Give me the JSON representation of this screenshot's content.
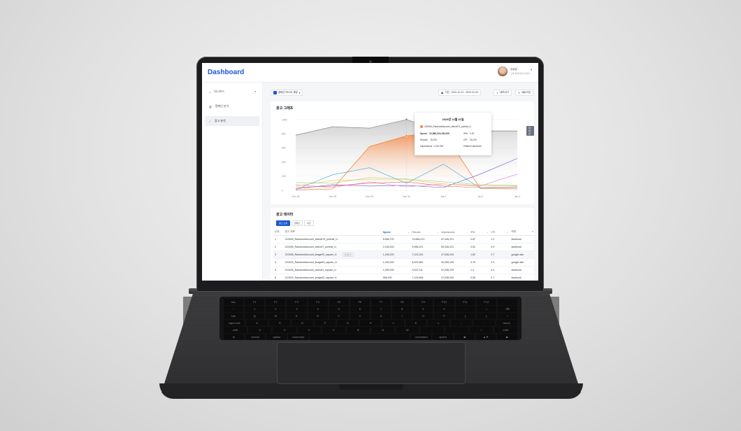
{
  "app": {
    "title": "Dashboard",
    "user": {
      "name": "김유정",
      "subtitle": "고객 데이터 분석 담당자"
    }
  },
  "sidebar": {
    "items": [
      {
        "label": "대시보드",
        "caret": "▾"
      },
      {
        "label": "캠페인 분석"
      },
      {
        "label": "광고 분석"
      }
    ]
  },
  "toolbar": {
    "account": "캠페인 마스터 계정",
    "date_range": "기간 : 2021.12.12 - 2022.01.03",
    "export": "내보내기",
    "refresh": "새로고침"
  },
  "chart_card": {
    "title": "광고 그래프",
    "end_badge": "최대값",
    "tooltip": {
      "title": "2024년 12월 31일",
      "series": "210506_Randomdiscount_video674_portrait_U",
      "rows": [
        {
          "label": "Spend",
          "value": "32,866,015,150,005"
        },
        {
          "label": "Results",
          "value": "15,220"
        },
        {
          "label": "Impressions",
          "value": "1,215,220"
        }
      ],
      "rows_right": [
        {
          "label": "IPM",
          "value": "0.87"
        },
        {
          "label": "CPI",
          "value": "15,220"
        },
        {
          "label": "Platform",
          "value": "facebook"
        }
      ]
    }
  },
  "chart_data": {
    "type": "line",
    "categories": [
      "Dec 28",
      "Dec 29",
      "Dec 30",
      "Dec 31",
      "Jan 1",
      "Jan 2",
      "Jan 3"
    ],
    "yticks": [
      "1000",
      "800",
      "600",
      "400",
      "200",
      "0"
    ],
    "ylim": [
      0,
      1000
    ],
    "series": [
      {
        "name": "총합",
        "color": "#8f8f8f",
        "area": true,
        "values": [
          780,
          900,
          880,
          1000,
          840,
          840,
          840
        ]
      },
      {
        "name": "210506_Randomdiscount_video674_portrait_U",
        "color": "#f4863e",
        "area": true,
        "values": [
          5,
          20,
          620,
          770,
          830,
          25,
          20
        ]
      },
      {
        "color": "#26a8e0",
        "values": [
          10,
          220,
          320,
          100,
          370,
          30,
          40
        ]
      },
      {
        "color": "#5b57d6",
        "values": [
          20,
          80,
          60,
          70,
          40,
          230,
          450
        ]
      },
      {
        "color": "#e07ad6",
        "values": [
          80,
          40,
          120,
          50,
          90,
          60,
          230
        ]
      },
      {
        "color": "#f2c14e",
        "values": [
          60,
          140,
          150,
          150,
          90,
          70,
          60
        ]
      },
      {
        "color": "#9bd17a",
        "values": [
          110,
          100,
          180,
          160,
          120,
          80,
          70
        ]
      },
      {
        "color": "#ef5a5a",
        "values": [
          40,
          60,
          100,
          120,
          60,
          40,
          50
        ]
      }
    ]
  },
  "table_card": {
    "title": "광고 데이터",
    "tabs": [
      "광고 소재",
      "캠페인",
      "세트"
    ],
    "headers": [
      "순위",
      "광고 제목",
      "Spend",
      "Results",
      "Impressions",
      "IPM",
      "CPI",
      "매체"
    ],
    "row_action": "상세보기",
    "rows": [
      [
        "1",
        "210505_Randomdiscount_video675_portrait_U",
        "8,566,720",
        "13,666,221",
        "87,036,221",
        "0.87",
        "1.2",
        "facebook"
      ],
      [
        "2",
        "210405_Randomdiscount_video97_portrait_U",
        "2,165,220",
        "9,066,221",
        "50,036,221",
        "0.52",
        "0.9",
        "facebook"
      ],
      [
        "3",
        "210305_Randomdiscount_image92_square_K",
        "1,165,220",
        "7,122,151",
        "47,036,220",
        "1.82",
        "2.7",
        "google ads"
      ],
      [
        "4",
        "210223_Randomdiscount_image83_square_U",
        "1,032,000",
        "8,022,662",
        "42,036,100",
        "0.76",
        "1.3",
        "google ads"
      ],
      [
        "5",
        "210425_Randomdiscount_video81_square_U",
        "1,005,330",
        "9,022,111",
        "47,036,220",
        "1.4",
        "0.4",
        "facebook"
      ],
      [
        "6",
        "210303_Randomdiscount_image52_square_K",
        "958,200",
        "7,129,606",
        "47,036,200",
        "0.50",
        "0.7",
        "facebook"
      ]
    ]
  },
  "keyboard": {
    "rows": [
      [
        "esc",
        "F1",
        "F2",
        "F3",
        "F4",
        "F5",
        "F6",
        "F7",
        "F8",
        "F9",
        "F10",
        "F11",
        "F12",
        ""
      ],
      [
        "~",
        "1",
        "2",
        "3",
        "4",
        "5",
        "6",
        "7",
        "8",
        "9",
        "0",
        "-",
        "=",
        "⌫"
      ],
      [
        "tab",
        "Q",
        "W",
        "E",
        "R",
        "T",
        "Y",
        "U",
        "I",
        "O",
        "P",
        "[",
        "]",
        "\\"
      ],
      [
        "caps lock",
        "A",
        "S",
        "D",
        "F",
        "G",
        "H",
        "J",
        "K",
        "L",
        ";",
        "'",
        "return"
      ],
      [
        "shift",
        "Z",
        "X",
        "C",
        "V",
        "B",
        "N",
        "M",
        ",",
        ".",
        "/",
        "shift"
      ],
      [
        "fn",
        "control",
        "option",
        "command",
        "",
        "command",
        "option",
        "◀",
        "▲▼",
        "▶"
      ]
    ]
  }
}
